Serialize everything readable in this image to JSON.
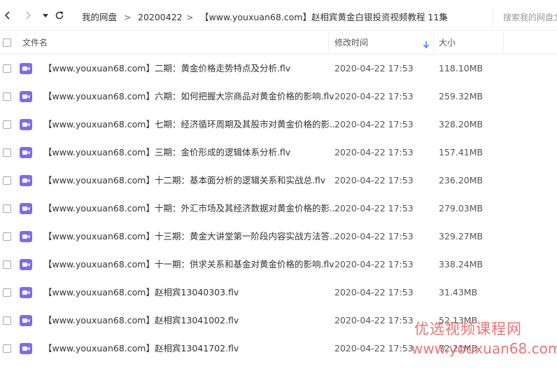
{
  "navbar": {
    "breadcrumbs": [
      "我的网盘",
      "20200422",
      "【www.youxuan68.com】赵相宾黄金白银投资视频教程 11集"
    ],
    "separator": ">",
    "search_placeholder": "搜索我的网盘文件"
  },
  "columns": {
    "name": "文件名",
    "modified": "修改时间",
    "size": "大小"
  },
  "files": [
    {
      "name": "【www.youxuan68.com】二期：黄金价格走势特点及分析.flv",
      "modified": "2020-04-22 17:53",
      "size": "118.10MB",
      "icon": "video-file-icon"
    },
    {
      "name": "【www.youxuan68.com】六期：如何把握大宗商品对黄金价格的影响.flv",
      "modified": "2020-04-22 17:53",
      "size": "259.32MB",
      "icon": "video-file-icon"
    },
    {
      "name": "【www.youxuan68.com】七期：经济循环周期及其股市对黄金价格的影...",
      "modified": "2020-04-22 17:53",
      "size": "328.20MB",
      "icon": "video-file-icon"
    },
    {
      "name": "【www.youxuan68.com】三期：金价形成的逻辑体系分析.flv",
      "modified": "2020-04-22 17:53",
      "size": "157.41MB",
      "icon": "video-file-icon"
    },
    {
      "name": "【www.youxuan68.com】十二期：基本面分析的逻辑关系和实战总.flv",
      "modified": "2020-04-22 17:53",
      "size": "236.20MB",
      "icon": "video-file-icon"
    },
    {
      "name": "【www.youxuan68.com】十期：外汇市场及其经济数据对黄金价格的影...",
      "modified": "2020-04-22 17:53",
      "size": "279.03MB",
      "icon": "video-file-icon"
    },
    {
      "name": "【www.youxuan68.com】十三期：黄金大讲堂第一阶段内容实战方法答...",
      "modified": "2020-04-22 17:53",
      "size": "329.27MB",
      "icon": "video-file-icon"
    },
    {
      "name": "【www.youxuan68.com】十一期：供求关系和基金对黄金价格的影响.flv",
      "modified": "2020-04-22 17:53",
      "size": "338.24MB",
      "icon": "video-file-icon"
    },
    {
      "name": "【www.youxuan68.com】赵相宾13040303.flv",
      "modified": "2020-04-22 17:53",
      "size": "31.43MB",
      "icon": "video-file-icon"
    },
    {
      "name": "【www.youxuan68.com】赵相宾13041002.flv",
      "modified": "2020-04-22 17:53",
      "size": "52.13MB",
      "icon": "video-file-icon"
    },
    {
      "name": "【www.youxuan68.com】赵相宾13041702.flv",
      "modified": "2020-04-22 17:53",
      "size": "72.21MB",
      "icon": "video-file-icon"
    }
  ],
  "watermark": {
    "line1": "优选视频课程网",
    "line2": "www.youxuan68.com"
  },
  "colors": {
    "video_icon": "#7b6cf0",
    "sort_arrow": "#3b8cff",
    "watermark": "#e85a5a"
  }
}
